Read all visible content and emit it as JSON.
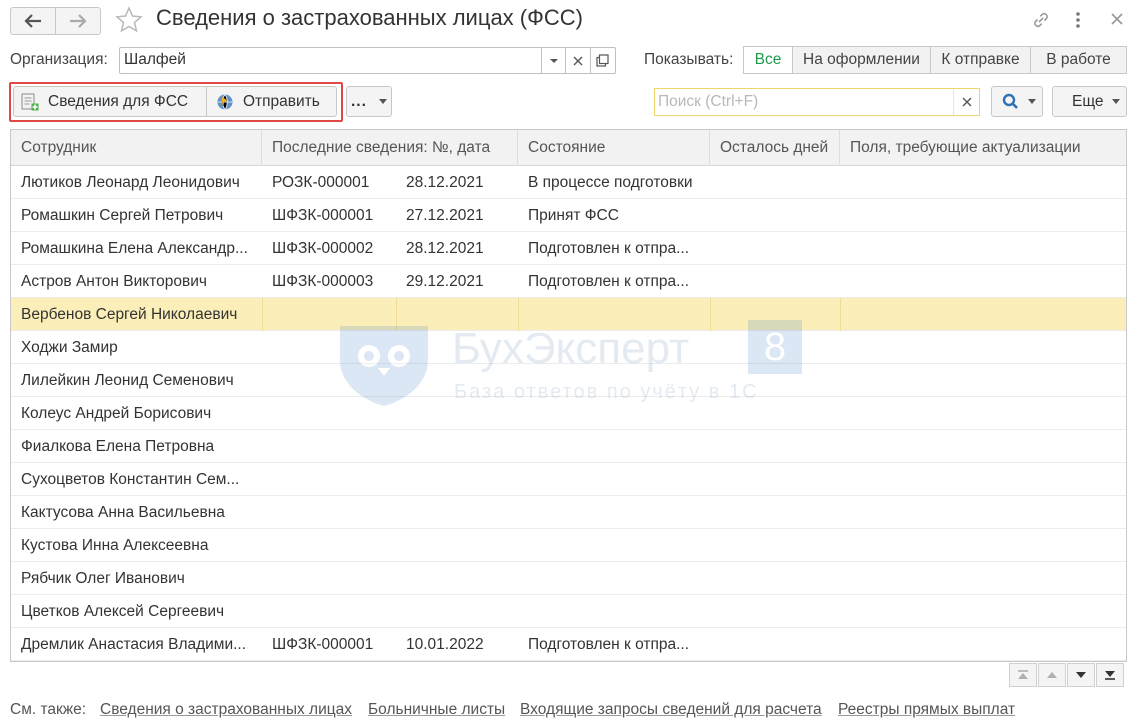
{
  "window": {
    "title": "Сведения о застрахованных лицах (ФСС)"
  },
  "org": {
    "label": "Организация:",
    "value": "Шалфей"
  },
  "filter": {
    "label": "Показывать:",
    "options": [
      "Все",
      "На оформлении",
      "К отправке",
      "В работе"
    ],
    "active": "Все"
  },
  "toolbar": {
    "fss_button": "Сведения для ФСС",
    "send_button": "Отправить",
    "more_button": "...",
    "search_placeholder": "Поиск (Ctrl+F)",
    "more_menu": "Еще"
  },
  "table": {
    "columns": [
      "Сотрудник",
      "Последние сведения: №, дата",
      "Состояние",
      "Осталось дней",
      "Поля, требующие актуализации"
    ],
    "rows": [
      {
        "employee": "Лютиков Леонард Леонидович",
        "number": "РОЗК-000001",
        "date": "28.12.2021",
        "status": "В процессе подготовки"
      },
      {
        "employee": "Ромашкин Сергей Петрович",
        "number": "ШФЗК-000001",
        "date": "27.12.2021",
        "status": "Принят ФСС"
      },
      {
        "employee": "Ромашкина Елена Александр...",
        "number": "ШФЗК-000002",
        "date": "28.12.2021",
        "status": "Подготовлен к отпра..."
      },
      {
        "employee": "Астров Антон Викторович",
        "number": "ШФЗК-000003",
        "date": "29.12.2021",
        "status": "Подготовлен к отпра..."
      },
      {
        "employee": "Вербенов Сергей Николаевич",
        "number": "",
        "date": "",
        "status": ""
      },
      {
        "employee": "Ходжи Замир",
        "number": "",
        "date": "",
        "status": ""
      },
      {
        "employee": "Лилейкин Леонид Семенович",
        "number": "",
        "date": "",
        "status": ""
      },
      {
        "employee": "Колеус Андрей Борисович",
        "number": "",
        "date": "",
        "status": ""
      },
      {
        "employee": "Фиалкова Елена Петровна",
        "number": "",
        "date": "",
        "status": ""
      },
      {
        "employee": "Сухоцветов Константин Сем...",
        "number": "",
        "date": "",
        "status": ""
      },
      {
        "employee": "Кактусова Анна Васильевна",
        "number": "",
        "date": "",
        "status": ""
      },
      {
        "employee": "Кустова Инна Алексеевна",
        "number": "",
        "date": "",
        "status": ""
      },
      {
        "employee": "Рябчик Олег Иванович",
        "number": "",
        "date": "",
        "status": ""
      },
      {
        "employee": "Цветков Алексей Сергеевич",
        "number": "",
        "date": "",
        "status": ""
      },
      {
        "employee": "Дремлик Анастасия Владими...",
        "number": "ШФЗК-000001",
        "date": "10.01.2022",
        "status": "Подготовлен к отпра..."
      }
    ],
    "selected_row": 4
  },
  "watermark": {
    "brand": "БухЭксперт",
    "badge": "8",
    "tagline": "База ответов по учёту в 1С"
  },
  "footer": {
    "see_also": "См. также:",
    "links": [
      "Сведения о застрахованных лицах",
      "Больничные листы",
      "Входящие запросы сведений для расчета",
      "Реестры прямых выплат"
    ]
  },
  "colors": {
    "accent_green": "#1f9a4a",
    "selection": "#fbeeb8",
    "highlight_frame": "#e04848",
    "search_border": "#ecd86a"
  }
}
